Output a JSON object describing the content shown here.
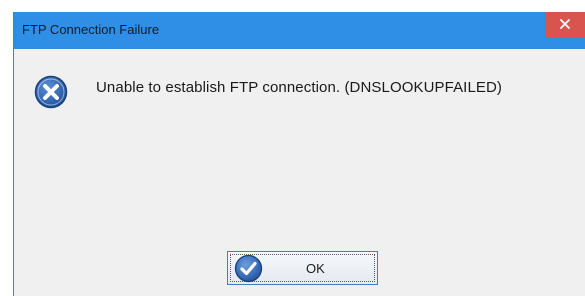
{
  "window": {
    "title": "FTP Connection Failure",
    "close_icon": "close-icon",
    "titlebar_color": "#2f8fe6",
    "close_color": "#d9534f"
  },
  "dialog": {
    "icon": "error-icon",
    "message": "Unable to establish FTP connection. (DNSLOOKUPFAILED)"
  },
  "buttons": {
    "ok_label": "OK",
    "ok_icon": "checkmark-icon"
  }
}
